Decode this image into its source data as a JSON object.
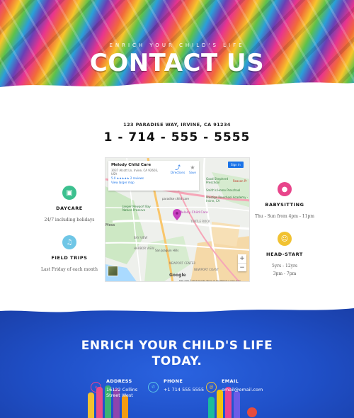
{
  "hero": {
    "subtitle": "ENRICH YOUR CHILD'S LIFE",
    "title": "CONTACT US"
  },
  "contact": {
    "address": "123 PARADISE WAY, IRVINE, CA 91234",
    "phone": "1 - 714 - 555 - 5555"
  },
  "features": [
    {
      "title": "DAYCARE",
      "desc": [
        "24/7 including holidays"
      ],
      "color": "#3cc08f",
      "icon": "building-icon"
    },
    {
      "title": "FIELD TRIPS",
      "desc": [
        "Last Friday of each month"
      ],
      "color": "#6fc6e6",
      "icon": "bell-icon"
    },
    {
      "title": "BABYSITTING",
      "desc": [
        "Thu - Sun from 4pm - 11pm"
      ],
      "color": "#e8458b",
      "icon": "person-icon"
    },
    {
      "title": "HEAD-START",
      "desc": [
        "5yrs - 12yrs",
        "3pm - 7pm"
      ],
      "color": "#f1c232",
      "icon": "smiley-icon"
    }
  ],
  "map": {
    "place_name": "Melody Child Care",
    "place_address": "3037 Alcott Ln, Irvine, CA 92603, USA",
    "rating": "5.0 ★★★★★",
    "reviews": "2 reviews",
    "view_larger": "View larger map",
    "directions": "Directions",
    "save": "Save",
    "sign_in": "Sign in",
    "pin_label": "Melody Child Care",
    "pois": [
      "Good Shepherd Preschool",
      "Smith's Home Preschool",
      "Prestige Preschool Academy - Irvine, CA",
      "paradise child care",
      "Jaeger Newport Bay Nature Preserve",
      "San Joaquin Hills",
      "Mesa",
      "Reason Pr",
      "TURTLE ROCK",
      "NEWPORT CENTER",
      "HARBOR VIEW",
      "BAY VIEW",
      "NEWPORT COAST"
    ],
    "google": "Google",
    "terms": "Map data ©2019 Google   Terms of Use   Report a map error",
    "zoom_in": "+",
    "zoom_out": "−"
  },
  "footer": {
    "title_line1": "ENRICH YOUR CHILD'S LIFE",
    "title_line2": "TODAY.",
    "address_label": "ADDRESS",
    "address_line1": "16122 Collins",
    "address_line2": "Street West",
    "phone_label": "PHONE",
    "phone_value": "+1 714 555 5555",
    "email_label": "EMAIL",
    "email_value": "email@email.com"
  }
}
